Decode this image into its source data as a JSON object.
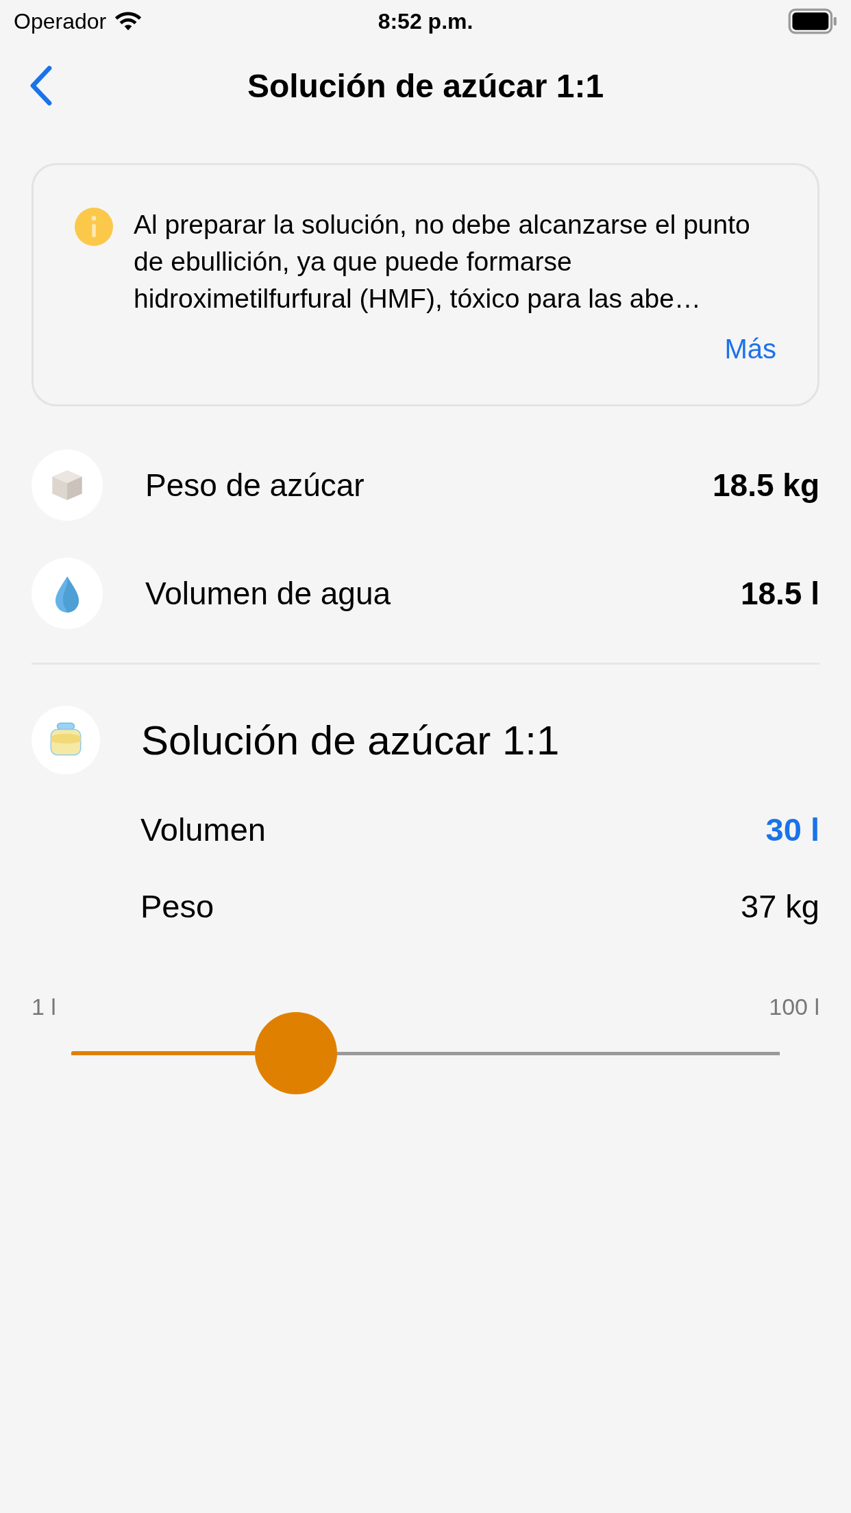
{
  "status_bar": {
    "carrier": "Operador",
    "time": "8:52 p.m."
  },
  "nav": {
    "title": "Solución de azúcar 1:1"
  },
  "notice": {
    "text": "Al preparar la solución, no debe alcanzarse el punto de ebullición, ya que puede formarse hidroximetilfurfural (HMF), tóxico para las abe…",
    "link": "Más"
  },
  "ingredients": [
    {
      "kind": "sugar",
      "label": "Peso de azúcar",
      "value": "18.5 kg"
    },
    {
      "kind": "water",
      "label": "Volumen de agua",
      "value": "18.5 l"
    }
  ],
  "solution": {
    "title": "Solución de azúcar 1:1",
    "rows": [
      {
        "label": "Volumen",
        "value": "30 l",
        "selected": true
      },
      {
        "label": "Peso",
        "value": "37 kg",
        "selected": false
      }
    ]
  },
  "slider": {
    "min_label": "1 l",
    "max_label": "100 l",
    "level": 0.293
  }
}
